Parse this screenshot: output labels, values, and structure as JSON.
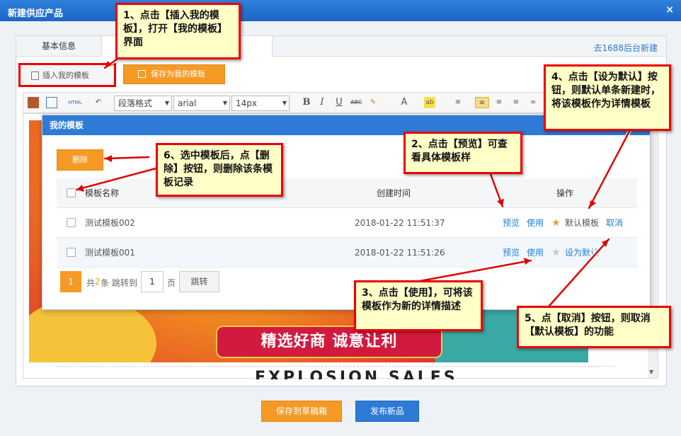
{
  "window": {
    "title": "新建供应产品",
    "close": "×"
  },
  "tabs": {
    "basic": "基本信息",
    "link_right": "去1688后台新建"
  },
  "buttons": {
    "insert": "插入我的模板",
    "save_as": "保存为我的模板",
    "delete": "删除",
    "save_draft": "保存到草稿箱",
    "publish": "发布新品"
  },
  "toolbar": {
    "format": "段落格式",
    "font": "arial",
    "size": "14px",
    "html": "HTML"
  },
  "modal": {
    "title": "我的模板"
  },
  "table": {
    "headers": [
      "模板名称",
      "创建时间",
      "操作"
    ],
    "rows": [
      {
        "name": "测试模板002",
        "time": "2018-01-22 11:51:37",
        "preview": "预览",
        "use": "使用",
        "star_label": "默认模板",
        "cancel": "取消"
      },
      {
        "name": "测试模板001",
        "time": "2018-01-22 11:51:26",
        "preview": "预览",
        "use": "使用",
        "star_label": "设为默认"
      }
    ]
  },
  "pager": {
    "current": "1",
    "total_prefix": "共",
    "total": "2",
    "total_suffix": "条",
    "jump_label": "跳转到",
    "input": "1",
    "page_unit": "页",
    "jump_btn": "跳转"
  },
  "banner": {
    "slogan": "精选好商 诚意让利",
    "explosion": "EXPLOSION SALES"
  },
  "notes": {
    "n1": "1、点击【插入我的模板】，打开【我的模板】界面",
    "n2": "2、点击【预览】可查看具体模板样",
    "n3": "3、点击【使用】，可将该模板作为新的详情描述",
    "n4": "4、点击【设为默认】按钮，则默认单条新建时，将该模板作为详情模板",
    "n5": "5、点【取消】按钮，则取消【默认模板】的功能",
    "n6": "6、选中模板后，点【删除】按钮，则删除该条模板记录"
  },
  "colors": {
    "accent": "#2d7bd6",
    "orange": "#f59a25",
    "note_border": "#e00000",
    "note_bg": "#ffffc8"
  }
}
